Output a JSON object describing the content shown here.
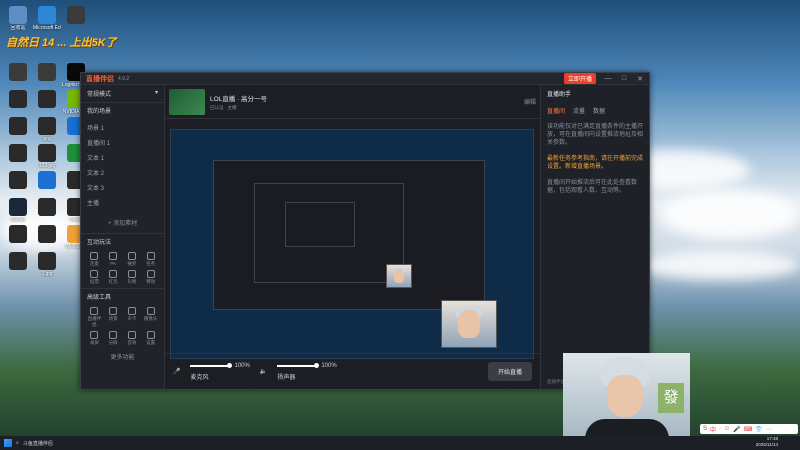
{
  "overlay": {
    "text": "自然日 14  ... 上出5K了"
  },
  "desktop_icons": [
    {
      "label": "回收站",
      "color": "#5e8fc4"
    },
    {
      "label": "Microsoft Edge",
      "color": "#2d86d6"
    },
    {
      "label": "",
      "color": "#3a3a3a"
    },
    {
      "label": "",
      "color": "#3a3a3a"
    },
    {
      "label": "",
      "color": "#3a3a3a"
    },
    {
      "label": "Logitech G HUB",
      "color": "#0a0a0a"
    },
    {
      "label": "",
      "color": "#2a2a2a"
    },
    {
      "label": "",
      "color": "#2a2a2a"
    },
    {
      "label": "NVIDIA App",
      "color": "#77b900"
    },
    {
      "label": "",
      "color": "#2a2a2a"
    },
    {
      "label": ".png",
      "color": "#2a2a2a"
    },
    {
      "label": "",
      "color": "#1870d5"
    },
    {
      "label": "",
      "color": "#2a2a2a"
    },
    {
      "label": "123.jpg",
      "color": "#2a2a2a"
    },
    {
      "label": "",
      "color": "#1f8f3c"
    },
    {
      "label": "",
      "color": "#2a2a2a"
    },
    {
      "label": "",
      "color": "#1d6fd1"
    },
    {
      "label": "",
      "color": "#2a2a2a"
    },
    {
      "label": "Steam",
      "color": "#1b2838"
    },
    {
      "label": "",
      "color": "#2a2a2a"
    },
    {
      "label": "5.png",
      "color": "#2a2a2a"
    },
    {
      "label": "",
      "color": "#2a2a2a"
    },
    {
      "label": "",
      "color": "#2a2a2a"
    },
    {
      "label": "WeGame",
      "color": "#f0a23a"
    },
    {
      "label": "",
      "color": "#2a2a2a"
    },
    {
      "label": "1.jpg",
      "color": "#2a2a2a"
    }
  ],
  "app": {
    "logo": "直播伴侣",
    "version": "4.9.2",
    "live_btn": "立即开播",
    "window_controls": [
      "—",
      "□",
      "✕"
    ],
    "left": {
      "header": "常规模式",
      "scenes_title": "我的场景",
      "scenes": [
        "场景 1",
        "直播间 1",
        "文本 1",
        "文本 2",
        "文本 3",
        "主播"
      ],
      "add_scene": "+ 添加素材",
      "tools_title": "互动玩法",
      "tools": [
        "连麦",
        "PK",
        "抽奖",
        "任务",
        "投票",
        "红包",
        "礼物",
        "特效"
      ],
      "tools2_title": "高级工具",
      "tools2": [
        "直播伴侣",
        "场景",
        "声卡",
        "摄像头",
        "录屏",
        "分屏",
        "音效",
        "设置"
      ],
      "more": "更多功能"
    },
    "room": {
      "title": "LOL直播 · 高分一号",
      "sub": "已认证 · 主播",
      "edit": "编辑"
    },
    "bottom": {
      "mic_label": "麦克风",
      "mic_value": "100%",
      "speaker_label": "扬声器",
      "speaker_value": "100%",
      "start": "开始直播"
    },
    "right": {
      "title": "直播助手",
      "tabs": [
        "直播间",
        "流量",
        "数据"
      ],
      "active_tab": 0,
      "text1": "该功能仅对已满足直播条件的主播开放，可在直播间内设置推流地址及相关参数。",
      "highlight": "最新任务参考指南，请在开播前完成设置。新增直播场景。",
      "text2": "直播间开始推流后可在此处查看数据，包括观看人数、互动等。",
      "footer_left": "直播伴侣 4.9.2",
      "footer_right": "CPU 6%  内存 41%"
    }
  },
  "taskbar": {
    "items": [
      "斗鱼直播伴侣"
    ],
    "time": "17:48",
    "date": "2025/11/14"
  },
  "ime": {
    "items": [
      "S",
      "中",
      "·",
      "☺",
      "🎤",
      "⌨",
      "👕",
      "⋯"
    ]
  },
  "webcam": {
    "sign": "發"
  }
}
